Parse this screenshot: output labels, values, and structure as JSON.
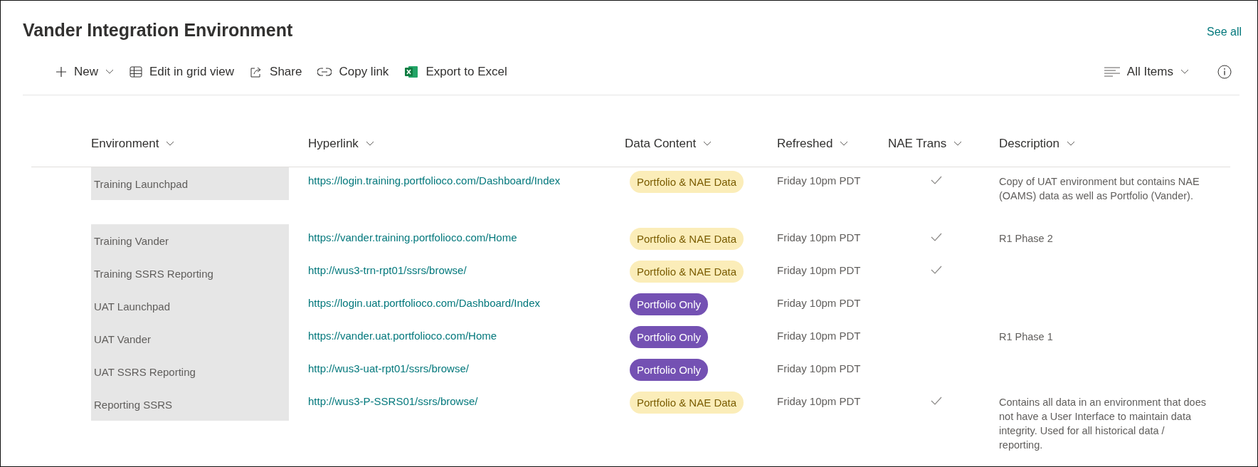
{
  "title": "Vander Integration Environment",
  "see_all": "See all",
  "toolbar": [
    {
      "kind": "new",
      "label": "New",
      "dropdown": true
    },
    {
      "kind": "grid",
      "label": "Edit in grid view",
      "dropdown": false
    },
    {
      "kind": "share",
      "label": "Share",
      "dropdown": false
    },
    {
      "kind": "link",
      "label": "Copy link",
      "dropdown": false
    },
    {
      "kind": "excel",
      "label": "Export to Excel",
      "dropdown": false
    }
  ],
  "view": {
    "label": "All Items"
  },
  "columns": [
    "Environment",
    "Hyperlink",
    "Data Content",
    "Refreshed",
    "NAE Trans",
    "Description"
  ],
  "rows": [
    {
      "environment": "Training Launchpad",
      "hyperlink": "https://login.training.portfolioco.com/Dashboard/Index",
      "data_content": {
        "label": "Portfolio & NAE Data",
        "color": "#fbedb9"
      },
      "refreshed": "Friday 10pm PDT",
      "nae_trans": true,
      "description": "Copy of UAT environment but contains NAE (OAMS) data as well as Portfolio (Vander)."
    },
    {
      "environment": "Training Vander",
      "hyperlink": "https://vander.training.portfolioco.com/Home",
      "data_content": {
        "label": "Portfolio & NAE Data",
        "color": "#fbedb9"
      },
      "refreshed": "Friday 10pm PDT",
      "nae_trans": true,
      "description": "R1 Phase 2"
    },
    {
      "environment": "Training SSRS Reporting",
      "hyperlink": "http://wus3-trn-rpt01/ssrs/browse/",
      "data_content": {
        "label": "Portfolio & NAE Data",
        "color": "#fbedb9"
      },
      "refreshed": "Friday 10pm PDT",
      "nae_trans": true
    },
    {
      "environment": "UAT Launchpad",
      "hyperlink": "https://login.uat.portfolioco.com/Dashboard/Index",
      "data_content": {
        "label": "Portfolio Only",
        "color": "#7451b3"
      },
      "refreshed": "Friday 10pm PDT",
      "nae_trans": false
    },
    {
      "environment": "UAT Vander",
      "hyperlink": "https://vander.uat.portfolioco.com/Home",
      "data_content": {
        "label": "Portfolio Only",
        "color": "#7451b3"
      },
      "refreshed": "Friday 10pm PDT",
      "nae_trans": false,
      "description": "R1 Phase 1"
    },
    {
      "environment": "UAT SSRS Reporting",
      "hyperlink": "http://wus3-uat-rpt01/ssrs/browse/",
      "data_content": {
        "label": "Portfolio Only",
        "color": "#7451b3"
      },
      "refreshed": "Friday 10pm PDT",
      "nae_trans": false
    },
    {
      "environment": "Reporting SSRS",
      "hyperlink": "http://wus3-P-SSRS01/ssrs/browse/",
      "data_content": {
        "label": "Portfolio & NAE Data",
        "color": "#fbedb9"
      },
      "refreshed": "Friday 10pm PDT",
      "nae_trans": true,
      "description": "Contains all data in an environment that does not have a User Interface to maintain data integrity. Used for all historical data / reporting."
    }
  ]
}
